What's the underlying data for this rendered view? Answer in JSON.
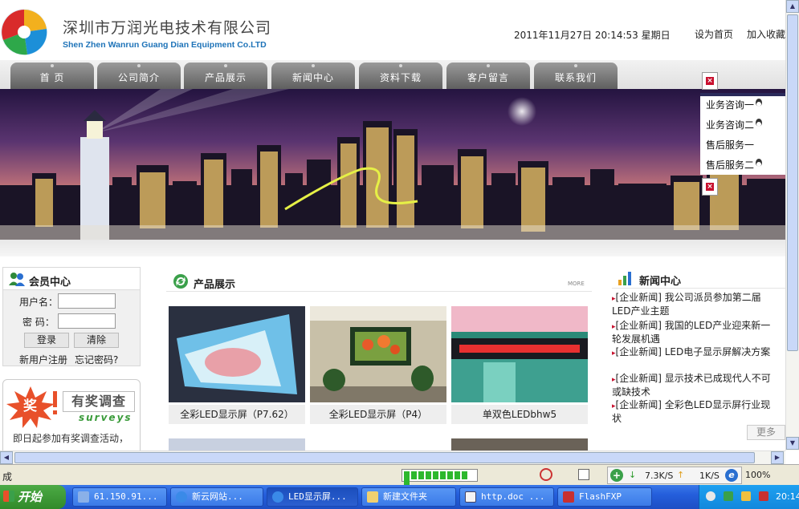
{
  "header": {
    "company_cn": "深圳市万润光电技术有限公司",
    "company_en": "Shen Zhen Wanrun Guang Dian Equipment Co.LTD",
    "datetime": "2011年11月27日  20:14:53 星期日",
    "set_home": "设为首页",
    "add_favorite": "加入收藏"
  },
  "nav": [
    "首 页",
    "公司简介",
    "产品展示",
    "新闻中心",
    "资料下载",
    "客户留言",
    "联系我们"
  ],
  "service_panel": {
    "close_label": "×",
    "items": [
      "业务咨询一",
      "业务咨询二",
      "售后服务一",
      "售后服务二"
    ]
  },
  "member": {
    "title": "会员中心",
    "username_label": "用户名：",
    "password_label": "密  码：",
    "login_button": "登录",
    "clear_button": "清除",
    "register_link": "新用户注册",
    "forgot_link": "忘记密码?"
  },
  "survey": {
    "badge": "奖",
    "title": "有奖调查",
    "subtitle": "surveys",
    "text": "即日起参加有奖调查活动，"
  },
  "products": {
    "title": "产品展示",
    "more": "MORE",
    "items": [
      "全彩LED显示屏（P7.62）",
      "全彩LED显示屏（P4）",
      "单双色LEDbhw5"
    ]
  },
  "news": {
    "title": "新闻中心",
    "items": [
      "[企业新闻] 我公司派员参加第二届LED产业主题",
      "[企业新闻] 我国的LED产业迎来新一轮发展机遇",
      "[企业新闻] LED电子显示屏解决方案",
      "[企业新闻] 显示技术已成现代人不可或缺技术",
      "[企业新闻] 全彩色LED显示屏行业现状"
    ],
    "more": "更多"
  },
  "statusbar": {
    "status": "成",
    "download_speed": "7.3K/S",
    "upload_speed": "1K/S",
    "zoom": "100%"
  },
  "taskbar": {
    "start": "开始",
    "tasks": [
      "61.150.91...",
      "新云网站...",
      "LED显示屏...",
      "新建文件夹",
      "http.doc ...",
      "FlashFXP"
    ],
    "clock": "20:14"
  }
}
